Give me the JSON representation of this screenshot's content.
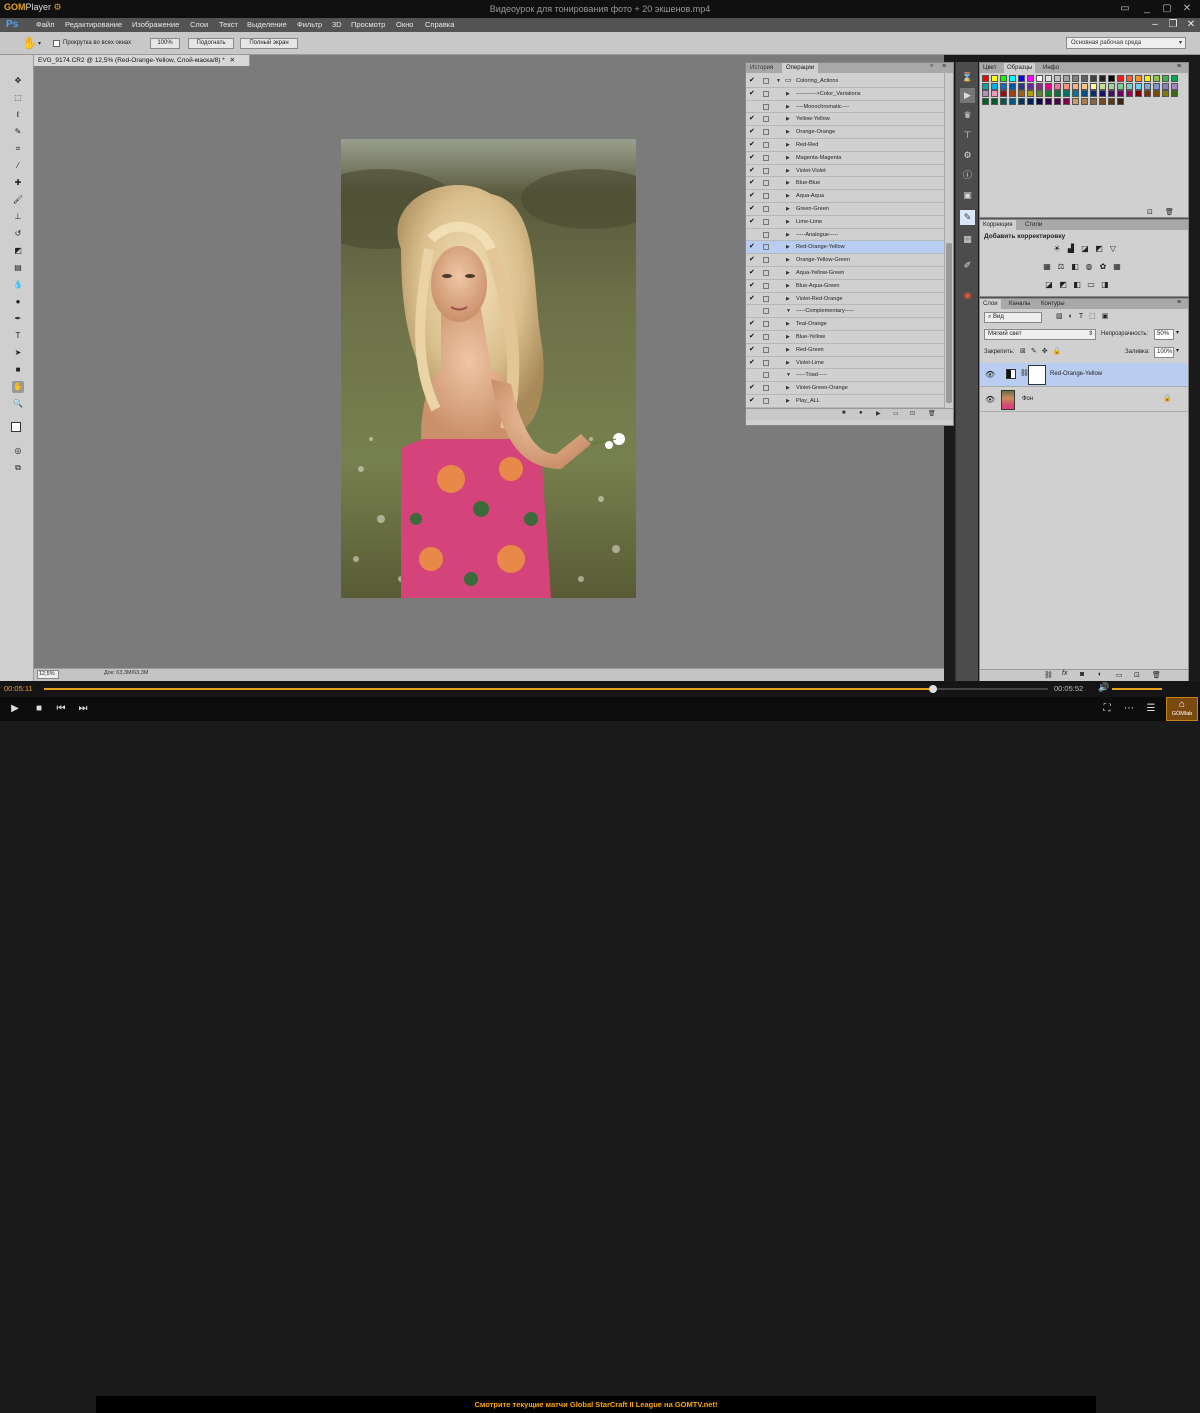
{
  "player": {
    "logo_prefix": "GOM",
    "logo_suffix": "Player",
    "title": "Видеоурок для тонирования фото + 20 экшенов.mp4",
    "time_current": "00:05:11",
    "time_total": "00:05:52",
    "progress_fraction": 0.885,
    "ticker": "Смотрите текущие матчи Global StarCraft II League на GOMTV.net!",
    "gomlab_label": "GOMlab"
  },
  "ps": {
    "logo": "Ps",
    "menu": [
      "Файл",
      "Редактирование",
      "Изображение",
      "Слои",
      "Текст",
      "Выделение",
      "Фильтр",
      "3D",
      "Просмотр",
      "Окно",
      "Справка"
    ],
    "options": {
      "scroll_all_label": "Прокрутка во всех окнах",
      "zoom_btn": "100%",
      "fit_btn": "Подогнать",
      "full_btn": "Полный экран"
    },
    "workspace": "Основная рабочая среда",
    "doc_tab": "EVG_9174.CR2 @ 12,5% (Red-Orange-Yellow, Слой-маска/8) *",
    "zoom_status": "12,5%",
    "doc_info": "Док: 63,3M/63,3M",
    "actions_panel": {
      "tab_history": "История",
      "tab_actions": "Операции",
      "items": [
        {
          "label": "Coloring_Actions",
          "check": "✔",
          "indent": 0,
          "open": true,
          "folder": true,
          "selected": false
        },
        {
          "label": "----------->Color_Variations",
          "check": "✔",
          "indent": 1,
          "open": false,
          "folder": false,
          "selected": false
        },
        {
          "label": "----Monochromatic----",
          "check": "",
          "indent": 1,
          "open": false,
          "folder": false,
          "selected": false
        },
        {
          "label": "Yellow-Yellow",
          "check": "✔",
          "indent": 1,
          "open": false,
          "folder": false,
          "selected": false
        },
        {
          "label": "Orange-Orange",
          "check": "✔",
          "indent": 1,
          "open": false,
          "folder": false,
          "selected": false
        },
        {
          "label": "Red-Red",
          "check": "✔",
          "indent": 1,
          "open": false,
          "folder": false,
          "selected": false
        },
        {
          "label": "Magenta-Magenta",
          "check": "✔",
          "indent": 1,
          "open": false,
          "folder": false,
          "selected": false
        },
        {
          "label": "Violet-Violet",
          "check": "✔",
          "indent": 1,
          "open": false,
          "folder": false,
          "selected": false
        },
        {
          "label": "Blue-Blue",
          "check": "✔",
          "indent": 1,
          "open": false,
          "folder": false,
          "selected": false
        },
        {
          "label": "Aqua-Aqua",
          "check": "✔",
          "indent": 1,
          "open": false,
          "folder": false,
          "selected": false
        },
        {
          "label": "Green-Green",
          "check": "✔",
          "indent": 1,
          "open": false,
          "folder": false,
          "selected": false
        },
        {
          "label": "Lime-Lime",
          "check": "✔",
          "indent": 1,
          "open": false,
          "folder": false,
          "selected": false
        },
        {
          "label": "-----Analogue-----",
          "check": "",
          "indent": 1,
          "open": false,
          "folder": false,
          "selected": false
        },
        {
          "label": "Red-Orange-Yellow",
          "check": "✔",
          "indent": 1,
          "open": false,
          "folder": false,
          "selected": true
        },
        {
          "label": "Orange-Yellow-Green",
          "check": "✔",
          "indent": 1,
          "open": false,
          "folder": false,
          "selected": false
        },
        {
          "label": "Aqua-Yellow-Green",
          "check": "✔",
          "indent": 1,
          "open": false,
          "folder": false,
          "selected": false
        },
        {
          "label": "Blue-Aqua-Green",
          "check": "✔",
          "indent": 1,
          "open": false,
          "folder": false,
          "selected": false
        },
        {
          "label": "Violet-Red-Orange",
          "check": "✔",
          "indent": 1,
          "open": false,
          "folder": false,
          "selected": false
        },
        {
          "label": "-----Complementary-----",
          "check": "",
          "indent": 1,
          "open": true,
          "folder": false,
          "selected": false
        },
        {
          "label": "Teal-Orange",
          "check": "✔",
          "indent": 1,
          "open": false,
          "folder": false,
          "selected": false
        },
        {
          "label": "Blue-Yellow",
          "check": "✔",
          "indent": 1,
          "open": false,
          "folder": false,
          "selected": false
        },
        {
          "label": "Red-Green",
          "check": "✔",
          "indent": 1,
          "open": false,
          "folder": false,
          "selected": false
        },
        {
          "label": "Violet-Lime",
          "check": "✔",
          "indent": 1,
          "open": false,
          "folder": false,
          "selected": false
        },
        {
          "label": "-----Triad-----",
          "check": "",
          "indent": 1,
          "open": true,
          "folder": false,
          "selected": false
        },
        {
          "label": "Violet-Green-Orange",
          "check": "✔",
          "indent": 1,
          "open": false,
          "folder": false,
          "selected": false
        },
        {
          "label": "Play_ALL",
          "check": "✔",
          "indent": 1,
          "open": false,
          "folder": false,
          "selected": false
        }
      ]
    },
    "swatches_panel": {
      "tabs": [
        "Цвет",
        "Образцы",
        "Инфо"
      ],
      "colors": [
        "#ff0000",
        "#ffff00",
        "#00ff00",
        "#00ffff",
        "#0000ff",
        "#ff00ff",
        "#ffffff",
        "#e0e0e0",
        "#c0c0c0",
        "#a0a0a0",
        "#808080",
        "#606060",
        "#404040",
        "#202020",
        "#000000",
        "#ed1c24",
        "#f26522",
        "#f7941d",
        "#fff200",
        "#8dc63f",
        "#39b54a",
        "#00a651",
        "#00a99d",
        "#00aeef",
        "#0072bc",
        "#0054a6",
        "#2e3192",
        "#662d91",
        "#92278f",
        "#ec008c",
        "#f06eaa",
        "#f69679",
        "#f9ad81",
        "#fdc689",
        "#fff799",
        "#c4df9b",
        "#a3d39c",
        "#82ca9c",
        "#7accc8",
        "#6dcff6",
        "#7da7d9",
        "#8393ca",
        "#8781bd",
        "#a186be",
        "#bd8cbf",
        "#f49ac1",
        "#9e0b0f",
        "#a0410d",
        "#a36209",
        "#aba000",
        "#598527",
        "#1a7b30",
        "#007236",
        "#00746b",
        "#0076a3",
        "#004b80",
        "#003471",
        "#1b1464",
        "#440e62",
        "#630460",
        "#9e005d",
        "#790000",
        "#7b2e00",
        "#7d4900",
        "#827b00",
        "#406618",
        "#005e20",
        "#005826",
        "#005952",
        "#005b7f",
        "#003663",
        "#002157",
        "#0d004c",
        "#32004b",
        "#4b0049",
        "#7b0046",
        "#c69c6d",
        "#a67c52",
        "#8c6239",
        "#754c24",
        "#603913",
        "#3c2415"
      ]
    },
    "adjustments_panel": {
      "tabs": [
        "Коррекция",
        "Стили"
      ],
      "heading": "Добавить корректировку"
    },
    "layers_panel": {
      "tabs": [
        "Слои",
        "Каналы",
        "Контуры"
      ],
      "filter": "Вид",
      "blend_mode": "Мягкий свет",
      "opacity_label": "Непрозрачность:",
      "opacity_value": "50%",
      "lock_label": "Закрепить:",
      "fill_label": "Заливка:",
      "fill_value": "100%",
      "layers": [
        {
          "name": "Red-Orange-Yellow",
          "selected": true
        },
        {
          "name": "Фон",
          "selected": false
        }
      ]
    }
  }
}
